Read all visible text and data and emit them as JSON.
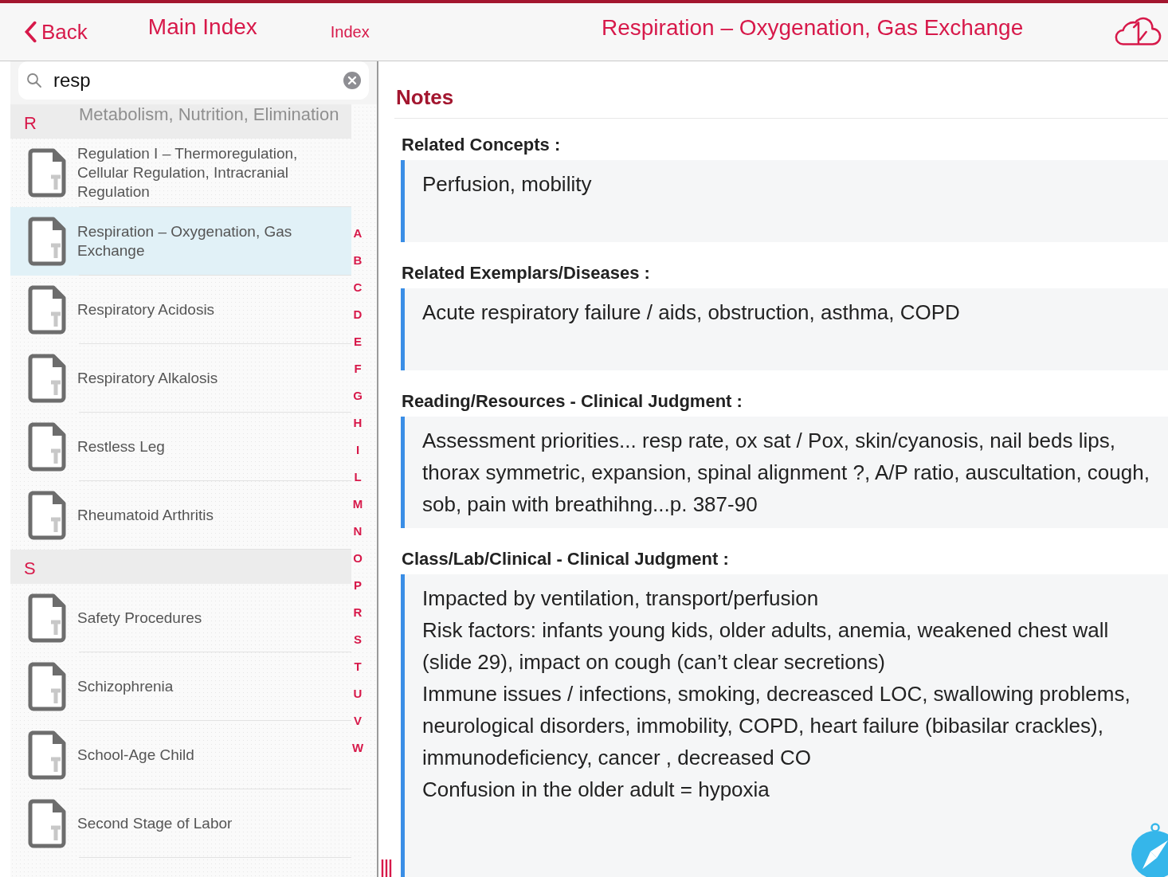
{
  "nav": {
    "back": "Back",
    "title": "Main Index",
    "index_tab": "Index",
    "page_title": "Respiration – Oxygenation, Gas Exchange"
  },
  "search": {
    "value": "resp"
  },
  "list": [
    {
      "kind": "section",
      "letter": "R",
      "faded_item": "Metabolism, Nutrition, Elimination"
    },
    {
      "kind": "item",
      "title": "Regulation I – Thermoregulation, Cellular Regulation, Intracranial Regulation",
      "selected": false
    },
    {
      "kind": "item",
      "title": "Respiration – Oxygenation, Gas Exchange",
      "selected": true
    },
    {
      "kind": "item",
      "title": "Respiratory Acidosis",
      "selected": false
    },
    {
      "kind": "item",
      "title": "Respiratory Alkalosis",
      "selected": false
    },
    {
      "kind": "item",
      "title": "Restless Leg",
      "selected": false
    },
    {
      "kind": "item",
      "title": "Rheumatoid Arthritis",
      "selected": false
    },
    {
      "kind": "section",
      "letter": "S"
    },
    {
      "kind": "item",
      "title": "Safety Procedures",
      "selected": false
    },
    {
      "kind": "item",
      "title": "Schizophrenia",
      "selected": false
    },
    {
      "kind": "item",
      "title": "School-Age Child",
      "selected": false
    },
    {
      "kind": "item",
      "title": "Second Stage of Labor",
      "selected": false
    }
  ],
  "index_letters": [
    "A",
    "B",
    "C",
    "D",
    "E",
    "F",
    "G",
    "H",
    "I",
    "L",
    "M",
    "N",
    "O",
    "P",
    "R",
    "S",
    "T",
    "U",
    "V",
    "W"
  ],
  "notes": {
    "heading": "Notes",
    "sections": [
      {
        "label": "Related Concepts :",
        "lines": [
          " Perfusion, mobility"
        ]
      },
      {
        "label": "Related Exemplars/Diseases :",
        "lines": [
          "Acute respiratory failure / aids, obstruction, asthma, COPD"
        ]
      },
      {
        "label": "Reading/Resources - Clinical Judgment :",
        "lines": [
          "Assessment priorities... resp rate, ox sat / Pox, skin/cyanosis, nail beds lips, thorax symmetric, expansion, spinal alignment ?,  A/P ratio, auscultation, cough, sob, pain with breathihng...p. 387-90"
        ]
      },
      {
        "label": "Class/Lab/Clinical - Clinical Judgment :",
        "lines": [
          " Impacted by ventilation, transport/perfusion",
          "Risk factors: infants young kids, older adults, anemia, weakened chest wall (slide 29), impact on cough (can’t clear secretions)",
          "Immune issues / infections, smoking, decreasced LOC, swallowing problems, neurological disorders, immobility, COPD, heart failure (bibasilar crackles), immunodeficiency, cancer , decreased CO",
          "Confusion in the older adult = hypoxia"
        ]
      }
    ]
  }
}
